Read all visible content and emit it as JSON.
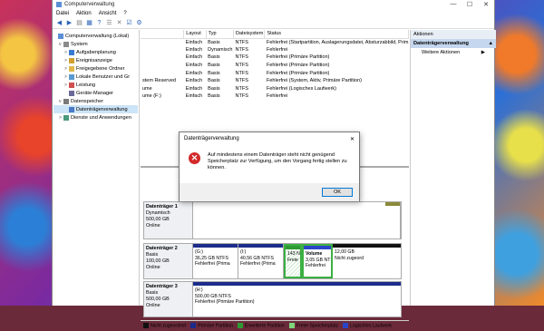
{
  "window": {
    "title": "Computerverwaltung",
    "controls": {
      "minimize": "—",
      "maximize": "☐",
      "close": "✕"
    }
  },
  "menu": [
    "Datei",
    "Aktion",
    "Ansicht",
    "?"
  ],
  "tree": {
    "items": [
      {
        "label": "Computerverwaltung (Lokal)",
        "indent": 0,
        "expander": "",
        "selected": false,
        "icon": "computer-icon"
      },
      {
        "label": "System",
        "indent": 1,
        "expander": "v",
        "selected": false,
        "icon": "tools-icon"
      },
      {
        "label": "Aufgabenplanung",
        "indent": 2,
        "expander": ">",
        "selected": false,
        "icon": "clock-icon"
      },
      {
        "label": "Ereignisanzeige",
        "indent": 2,
        "expander": ">",
        "selected": false,
        "icon": "event-icon"
      },
      {
        "label": "Freigegebene Ordner",
        "indent": 2,
        "expander": ">",
        "selected": false,
        "icon": "folder-icon"
      },
      {
        "label": "Lokale Benutzer und Gr",
        "indent": 2,
        "expander": ">",
        "selected": false,
        "icon": "users-icon"
      },
      {
        "label": "Leistung",
        "indent": 2,
        "expander": ">",
        "selected": false,
        "icon": "performance-icon"
      },
      {
        "label": "Geräte-Manager",
        "indent": 2,
        "expander": "",
        "selected": false,
        "icon": "device-icon"
      },
      {
        "label": "Datenspeicher",
        "indent": 1,
        "expander": "v",
        "selected": false,
        "icon": "storage-icon"
      },
      {
        "label": "Datenträgerverwaltung",
        "indent": 2,
        "expander": "",
        "selected": true,
        "icon": "disk-icon"
      },
      {
        "label": "Dienste und Anwendungen",
        "indent": 1,
        "expander": ">",
        "selected": false,
        "icon": "services-icon"
      }
    ]
  },
  "volumes": {
    "headers": [
      "",
      "Layout",
      "Typ",
      "Dateisystem",
      "Status"
    ],
    "rows": [
      [
        "",
        "Einfach",
        "Basis",
        "NTFS",
        "Fehlerfrei (Startpartition, Auslagerungsdatei, Absturzabbild, Prim"
      ],
      [
        "",
        "Einfach",
        "Dynamisch",
        "NTFS",
        "Fehlerfrei"
      ],
      [
        "",
        "Einfach",
        "Basis",
        "NTFS",
        "Fehlerfrei (Primäre Partition)"
      ],
      [
        "",
        "Einfach",
        "Basis",
        "NTFS",
        "Fehlerfrei (Primäre Partition)"
      ],
      [
        "",
        "Einfach",
        "Basis",
        "NTFS",
        "Fehlerfrei (Primäre Partition)"
      ],
      [
        "stem Reserved",
        "Einfach",
        "Basis",
        "NTFS",
        "Fehlerfrei (System, Aktiv, Primäre Partition)"
      ],
      [
        "ume",
        "Einfach",
        "Basis",
        "NTFS",
        "Fehlerfrei (Logisches Laufwerk)"
      ],
      [
        "ume (F:)",
        "Einfach",
        "Basis",
        "NTFS",
        "Fehlerfrei"
      ]
    ]
  },
  "disks": [
    {
      "name": "Datenträger 1",
      "type": "Dynamisch",
      "size": "500,00 GB",
      "status": "Online"
    },
    {
      "name": "Datenträger 2",
      "type": "Basis",
      "size": "100,00 GB",
      "status": "Online",
      "partitions": [
        {
          "line1": "(G:)",
          "line2": "36,25 GB NTFS",
          "line3": "Fehlerfrei (Prima"
        },
        {
          "line1": "(I:)",
          "line2": "40,56 GB NTFS",
          "line3": "Fehlerfrei (Prima"
        },
        {
          "line1": "",
          "line2": "143 N",
          "line3": "Freie"
        },
        {
          "line1": "Volume",
          "line2": "3,05 GB NT",
          "line3": "Fehlerfrei"
        },
        {
          "line1": "",
          "line2": "12,00 GB",
          "line3": "Nicht zugeord"
        }
      ]
    },
    {
      "name": "Datenträger 3",
      "type": "Basis",
      "size": "500,00 GB",
      "status": "Online",
      "partitions": [
        {
          "line1": "(H:)",
          "line2": "500,00 GB NTFS",
          "line3": "Fehlerfrei (Primäre Partition)"
        }
      ]
    }
  ],
  "legend": [
    {
      "label": "Nicht zugeordnet",
      "color": "#111111"
    },
    {
      "label": "Primäre Partition",
      "color": "#1b2c8a"
    },
    {
      "label": "Erweiterte Partition",
      "color": "#2e9a33"
    },
    {
      "label": "Freier Speicherplatz",
      "color": "#7cd67c"
    },
    {
      "label": "Logisches Laufwerk",
      "color": "#2a46c8"
    }
  ],
  "actions": {
    "header": "Aktionen",
    "section": "Datenträgerverwaltung",
    "section_arrow": "▲",
    "item": "Weitere Aktionen",
    "item_arrow": "▶"
  },
  "dialog": {
    "title": "Datenträgerverwaltung",
    "close": "✕",
    "message": "Auf mindestens einem Datenträger steht nicht genügend Speicherplatz zur Verfügung, um den Vorgang fertig stellen zu können.",
    "ok_label": "OK"
  }
}
